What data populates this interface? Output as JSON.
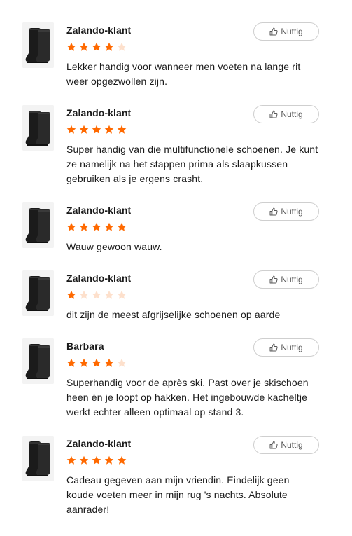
{
  "colors": {
    "star_filled": "#ff6900",
    "star_empty": "#fde0cc"
  },
  "helpful_icon": "thumbs-up-icon",
  "reviews": [
    {
      "author": "Zalando-klant",
      "rating": 4,
      "helpful_label": "Nuttig",
      "text": "Lekker handig voor wanneer men voeten na lange rit weer opgezwollen zijn."
    },
    {
      "author": "Zalando-klant",
      "rating": 5,
      "helpful_label": "Nuttig",
      "text": "Super handig van die multifunctionele schoenen. Je kunt ze namelijk na het stappen prima als slaapkussen gebruiken als je ergens crasht."
    },
    {
      "author": "Zalando-klant",
      "rating": 5,
      "helpful_label": "Nuttig",
      "text": "Wauw gewoon wauw."
    },
    {
      "author": "Zalando-klant",
      "rating": 1,
      "helpful_label": "Nuttig",
      "text": "dit zijn de meest afgrijselijke schoenen op aarde"
    },
    {
      "author": "Barbara",
      "rating": 4,
      "helpful_label": "Nuttig",
      "text": "Superhandig voor de après ski. Past over je skischoen heen én je loopt op hakken. Het ingebouwde kacheltje werkt echter alleen optimaal op stand 3."
    },
    {
      "author": "Zalando-klant",
      "rating": 5,
      "helpful_label": "Nuttig",
      "text": "Cadeau gegeven aan mijn vriendin. Eindelijk geen koude voeten meer in mijn rug 's nachts. Absolute aanrader!"
    }
  ]
}
